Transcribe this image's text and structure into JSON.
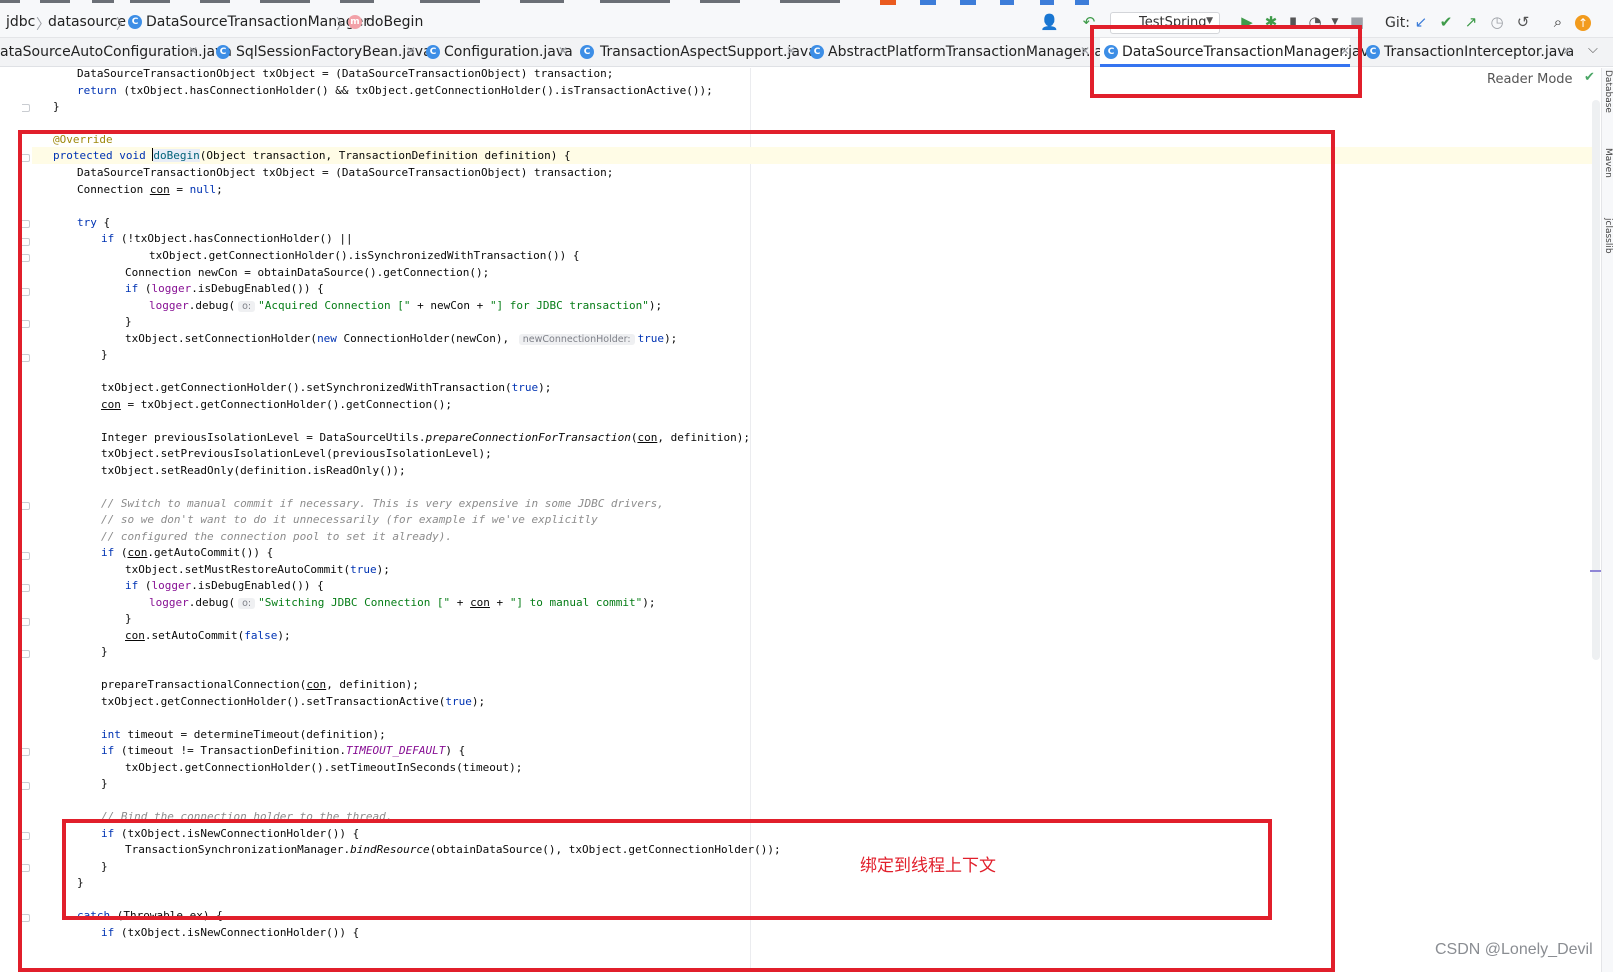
{
  "breadcrumb": {
    "items": [
      "jdbc",
      "datasource",
      "DataSourceTransactionManager",
      "doBegin"
    ]
  },
  "toolbar": {
    "run_config": "TestSpring",
    "git_label": "Git:"
  },
  "tabs": [
    {
      "label": "ataSourceAutoConfiguration.java",
      "active": false
    },
    {
      "label": "SqlSessionFactoryBean.java",
      "active": false
    },
    {
      "label": "Configuration.java",
      "active": false
    },
    {
      "label": "TransactionAspectSupport.java",
      "active": false
    },
    {
      "label": "AbstractPlatformTransactionManager.java",
      "active": false
    },
    {
      "label": "DataSourceTransactionManager.java",
      "active": true
    },
    {
      "label": "TransactionInterceptor.java",
      "active": false
    }
  ],
  "editor": {
    "reader_mode": "Reader Mode",
    "hints": {
      "param_o": "o:",
      "new_connection_holder": "newConnectionHolder:"
    }
  },
  "code": {
    "l1_decl": "DataSourceTransactionObject txObject = (DataSourceTransactionObject) transaction;",
    "l2_return": "return",
    "l2_rest": " (txObject.hasConnectionHolder() && txObject.getConnectionHolder().isTransactionActive());",
    "l3_close": "}",
    "l4_override": "@Override",
    "l5_protected": "protected",
    "l5_void": "void",
    "l5_name": "doBegin",
    "l5_rest": "(Object transaction, TransactionDefinition definition) {",
    "l6_decl": "DataSourceTransactionObject txObject = (DataSourceTransactionObject) transaction;",
    "l7_a": "Connection ",
    "l7_con": "con",
    "l7_b": " = ",
    "l7_null": "null",
    "l7_c": ";",
    "l8_try": "try",
    "l8_rest": " {",
    "l9_if": "if",
    "l9_rest": " (!txObject.hasConnectionHolder() ||",
    "l10": "txObject.getConnectionHolder().isSynchronizedWithTransaction()) {",
    "l11": "Connection newCon = obtainDataSource().getConnection();",
    "l12_if": "if",
    "l12_a": " (",
    "l12_logger": "logger",
    "l12_b": ".isDebugEnabled()) {",
    "l13_logger": "logger",
    "l13_a": ".debug(",
    "l13_str": "\"Acquired Connection [\"",
    "l13_b": " + newCon + ",
    "l13_str2": "\"] for JDBC transaction\"",
    "l13_c": ");",
    "l14": "}",
    "l15_a": "txObject.setConnectionHolder(",
    "l15_new": "new",
    "l15_b": " ConnectionHolder(newCon), ",
    "l15_true": "true",
    "l15_c": ");",
    "l16": "}",
    "l17_a": "txObject.getConnectionHolder().setSynchronizedWithTransaction(",
    "l17_true": "true",
    "l17_b": ");",
    "l18_con": "con",
    "l18_rest": " = txObject.getConnectionHolder().getConnection();",
    "l19_a": "Integer previousIsolationLevel = DataSourceUtils.",
    "l19_m": "prepareConnectionForTransaction",
    "l19_b": "(",
    "l19_con": "con",
    "l19_c": ", definition);",
    "l20": "txObject.setPreviousIsolationLevel(previousIsolationLevel);",
    "l21": "txObject.setReadOnly(definition.isReadOnly());",
    "l22": "// Switch to manual commit if necessary. This is very expensive in some JDBC drivers,",
    "l23": "// so we don't want to do it unnecessarily (for example if we've explicitly",
    "l24": "// configured the connection pool to set it already).",
    "l25_if": "if",
    "l25_a": " (",
    "l25_con": "con",
    "l25_b": ".getAutoCommit()) {",
    "l26_a": "txObject.setMustRestoreAutoCommit(",
    "l26_true": "true",
    "l26_b": ");",
    "l27_if": "if",
    "l27_a": " (",
    "l27_logger": "logger",
    "l27_b": ".isDebugEnabled()) {",
    "l28_logger": "logger",
    "l28_a": ".debug(",
    "l28_str": "\"Switching JDBC Connection [\"",
    "l28_b": " + ",
    "l28_con": "con",
    "l28_c": " + ",
    "l28_str2": "\"] to manual commit\"",
    "l28_d": ");",
    "l29": "}",
    "l30_con": "con",
    "l30_a": ".setAutoCommit(",
    "l30_false": "false",
    "l30_b": ");",
    "l31": "}",
    "l32_a": "prepareTransactionalConnection(",
    "l32_con": "con",
    "l32_b": ", definition);",
    "l33_a": "txObject.getConnectionHolder().setTransactionActive(",
    "l33_true": "true",
    "l33_b": ");",
    "l34_int": "int",
    "l34_rest": " timeout = determineTimeout(definition);",
    "l35_if": "if",
    "l35_a": " (timeout != TransactionDefinition.",
    "l35_const": "TIMEOUT_DEFAULT",
    "l35_b": ") {",
    "l36": "txObject.getConnectionHolder().setTimeoutInSeconds(timeout);",
    "l37": "}",
    "l38": "// Bind the connection holder to the thread.",
    "l39_if": "if",
    "l39_rest": " (txObject.isNewConnectionHolder()) {",
    "l40_a": "TransactionSynchronizationManager.",
    "l40_m": "bindResource",
    "l40_b": "(obtainDataSource(), txObject.getConnectionHolder());",
    "l41": "}",
    "l42": "}",
    "l43_catch": "catch",
    "l43_rest": " (Throwable ex) {",
    "l44_if": "if",
    "l44_rest": " (txObject.isNewConnectionHolder()) {"
  },
  "annotation": {
    "text": "绑定到线程上下文",
    "color": "#e11f2b"
  },
  "watermark": "CSDN @Lonely_Devil",
  "right_strip": {
    "labels": [
      "Database",
      "Maven",
      "jclasslib"
    ]
  }
}
